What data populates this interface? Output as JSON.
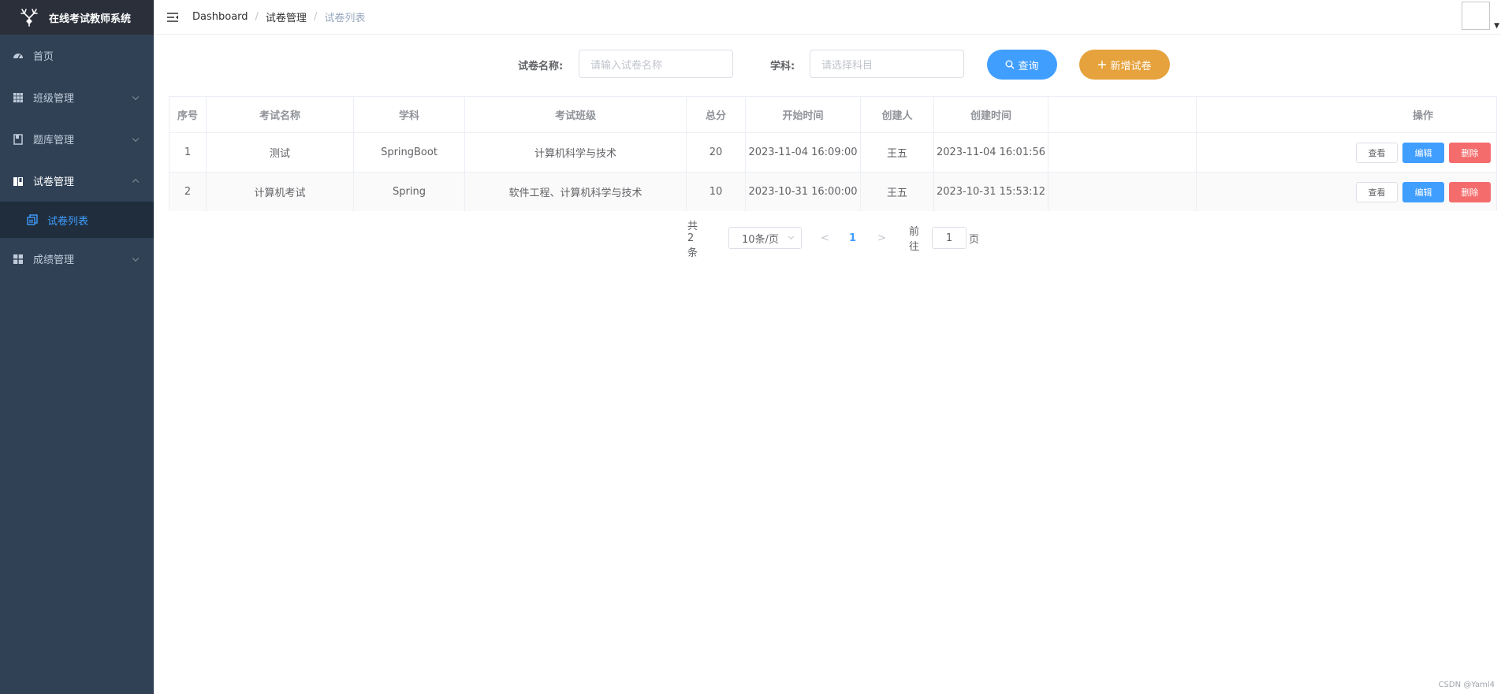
{
  "app": {
    "title": "在线考试教师系统",
    "logo_icon": "deer-antler-icon"
  },
  "sidebar": {
    "items": [
      {
        "label": "首页",
        "icon": "dashboard-icon"
      },
      {
        "label": "班级管理",
        "icon": "grid-icon"
      },
      {
        "label": "题库管理",
        "icon": "book-icon"
      },
      {
        "label": "试卷管理",
        "icon": "paper-icon",
        "expanded": true,
        "children": [
          {
            "label": "试卷列表",
            "icon": "copy-icon",
            "active": true
          }
        ]
      },
      {
        "label": "成绩管理",
        "icon": "apps-icon"
      }
    ]
  },
  "header": {
    "breadcrumb": [
      "Dashboard",
      "试卷管理",
      "试卷列表"
    ]
  },
  "filter": {
    "name_label": "试卷名称:",
    "name_placeholder": "请输入试卷名称",
    "subject_label": "学科:",
    "subject_placeholder": "请选择科目",
    "query_label": "查询",
    "add_label": "新增试卷"
  },
  "table": {
    "columns": [
      "序号",
      "考试名称",
      "学科",
      "考试班级",
      "总分",
      "开始时间",
      "创建人",
      "创建时间",
      "操作"
    ],
    "rows": [
      {
        "index": "1",
        "name": "测试",
        "subject": "SpringBoot",
        "classes": "计算机科学与技术",
        "score": "20",
        "start": "2023-11-04 16:09:00",
        "creator": "王五",
        "created": "2023-11-04 16:01:56"
      },
      {
        "index": "2",
        "name": "计算机考试",
        "subject": "Spring",
        "classes": "软件工程、计算机科学与技术",
        "score": "10",
        "start": "2023-10-31 16:00:00",
        "creator": "王五",
        "created": "2023-10-31 15:53:12"
      }
    ],
    "actions": {
      "view": "查看",
      "edit": "编辑",
      "delete": "删除"
    }
  },
  "pagination": {
    "total_text": "共 2 条",
    "page_size": "10条/页",
    "current_page": "1",
    "goto_prefix": "前往",
    "goto_value": "1",
    "goto_suffix": "页"
  },
  "watermark": "CSDN @Yaml4",
  "colors": {
    "primary": "#409eff",
    "warning": "#e6a23c",
    "danger": "#f56c6c",
    "sidebar": "#304156"
  }
}
